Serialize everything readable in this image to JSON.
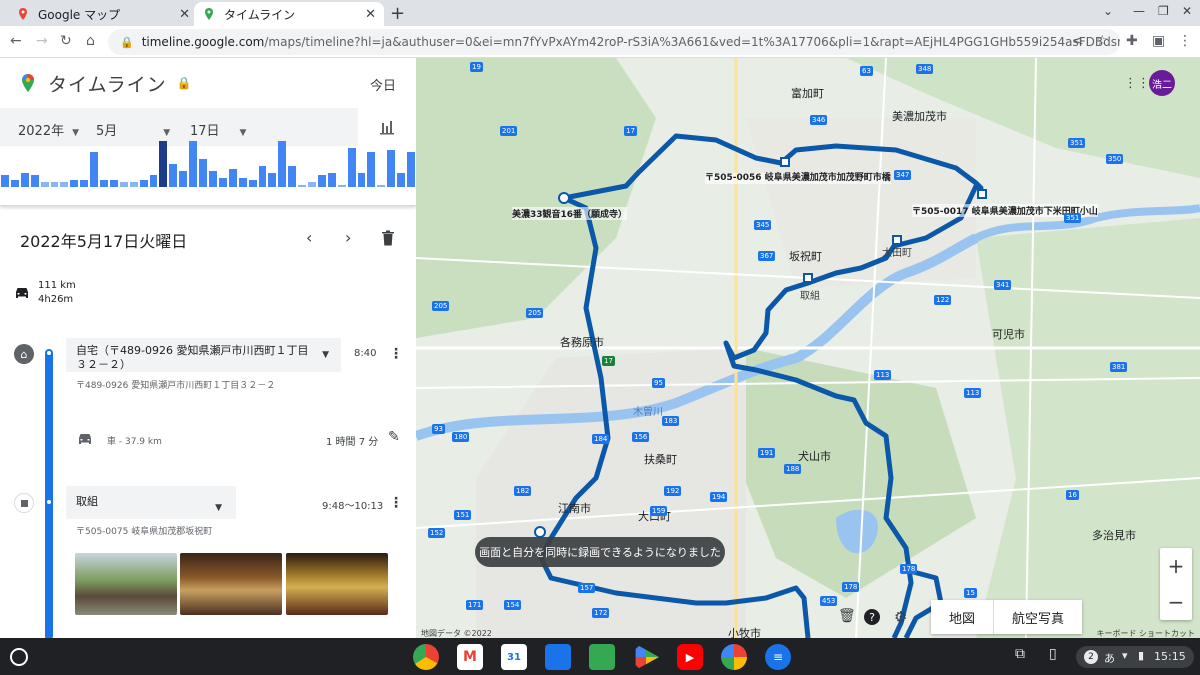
{
  "browser": {
    "tabs": [
      {
        "title": "Google マップ"
      },
      {
        "title": "タイムライン"
      }
    ],
    "url_host": "timeline.google.com",
    "url_path": "/maps/timeline?hl=ja&authuser=0&ei=mn7fYvPxAYm42roP-rS3iA%3A661&ved=1t%3A17706&pli=1&rapt=AEjHL4PGG1GHb559i254asFDBdsrNtIfp0cPfY_SMlK-0XTiwPt..."
  },
  "panel": {
    "title": "タイムライン",
    "today_label": "今日",
    "year": "2022年",
    "month": "5月",
    "day": "17日",
    "date_heading": "2022年5月17日火曜日",
    "distance": "111 km",
    "duration": "4h26m",
    "histogram": [
      0.25,
      0.15,
      0.3,
      0.25,
      0.1,
      0.1,
      0.1,
      0.15,
      0.15,
      0.75,
      0.15,
      0.15,
      0.1,
      0.1,
      0.15,
      0.25,
      1.0,
      0.5,
      0.35,
      1.0,
      0.6,
      0.35,
      0.2,
      0.4,
      0.2,
      0.15,
      0.45,
      0.3,
      1.0,
      0.45,
      0.05,
      0.1,
      0.25,
      0.3,
      0.05,
      0.85,
      0.3,
      0.75,
      0.05,
      0.8,
      0.3,
      0.75
    ]
  },
  "home_visit": {
    "name": "自宅（〒489-0926 愛知県瀬戸市川西町１丁目３２－２）",
    "address": "〒489-0926 愛知県瀬戸市川西町１丁目３２－２",
    "time": "8:40"
  },
  "drive": {
    "label": "車 - 37.9 km",
    "duration": "1 時間 7 分"
  },
  "visit2": {
    "name": "取組",
    "address": "〒505-0075 岐阜県加茂郡坂祝町",
    "time": "9:48〜10:13"
  },
  "map": {
    "labels": {
      "tomika": "富加町",
      "minokamo": "美濃加茂市",
      "sakahogi": "坂祝町",
      "kakamigahara": "各務原市",
      "kani": "可児市",
      "fuso": "扶桑町",
      "inuyama": "犬山市",
      "konan": "江南市",
      "oguchi": "大口町",
      "komaki": "小牧市",
      "tajimi": "多治見市",
      "ota": "太田町",
      "torikumi": "取組",
      "kisogawa": "木曽川"
    },
    "place1": "〒505-0056 岐阜県美濃加茂市加茂野町市橋",
    "place2": "〒505-0017 岐阜県美濃加茂市下米田町小山",
    "place3": "美濃33観音16番（願成寺）",
    "type_map": "地図",
    "type_sat": "航空写真",
    "toast": "画面と自分を同時に録画できるようになりました",
    "footer_data": "地図データ ©2022",
    "footer_kb": "キーボード ショートカット",
    "avatar": "浩二"
  },
  "system": {
    "time": "15:15",
    "notif_count": "2",
    "ime": "あ"
  }
}
